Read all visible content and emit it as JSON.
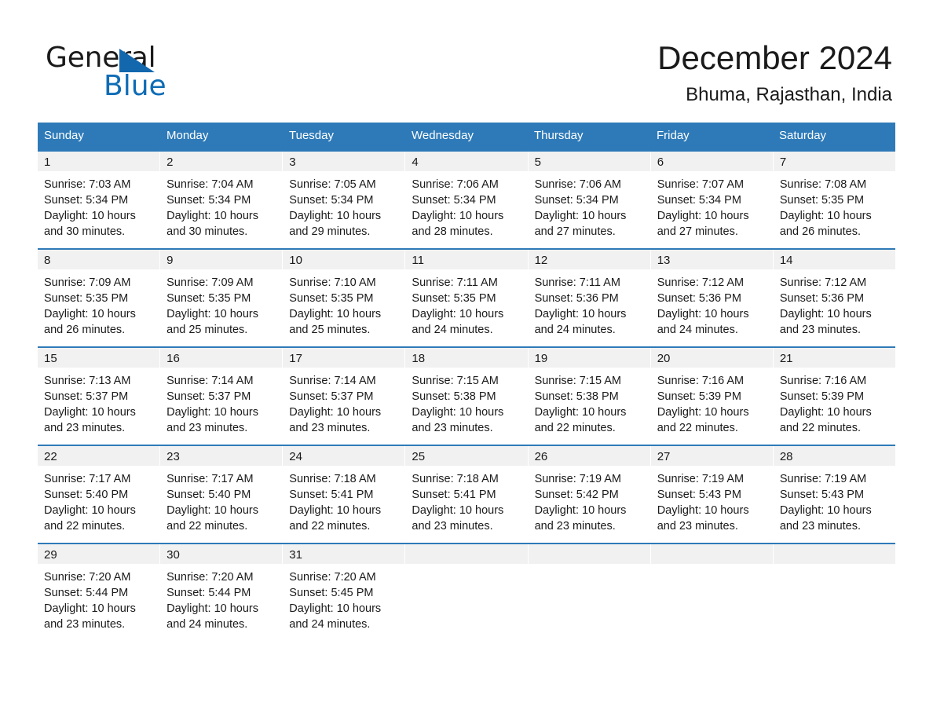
{
  "logo": {
    "word1": "General",
    "word2": "Blue",
    "triangle_color": "#1267ad",
    "blue_color": "#0f6cb5"
  },
  "header": {
    "title": "December 2024",
    "location": "Bhuma, Rajasthan, India"
  },
  "theme": {
    "header_blue": "#2e7ab8",
    "day_number_bg": "#f1f1f1"
  },
  "weekdays": [
    "Sunday",
    "Monday",
    "Tuesday",
    "Wednesday",
    "Thursday",
    "Friday",
    "Saturday"
  ],
  "weeks": [
    [
      {
        "day": "1",
        "sunrise": "Sunrise: 7:03 AM",
        "sunset": "Sunset: 5:34 PM",
        "daylight": "Daylight: 10 hours and 30 minutes."
      },
      {
        "day": "2",
        "sunrise": "Sunrise: 7:04 AM",
        "sunset": "Sunset: 5:34 PM",
        "daylight": "Daylight: 10 hours and 30 minutes."
      },
      {
        "day": "3",
        "sunrise": "Sunrise: 7:05 AM",
        "sunset": "Sunset: 5:34 PM",
        "daylight": "Daylight: 10 hours and 29 minutes."
      },
      {
        "day": "4",
        "sunrise": "Sunrise: 7:06 AM",
        "sunset": "Sunset: 5:34 PM",
        "daylight": "Daylight: 10 hours and 28 minutes."
      },
      {
        "day": "5",
        "sunrise": "Sunrise: 7:06 AM",
        "sunset": "Sunset: 5:34 PM",
        "daylight": "Daylight: 10 hours and 27 minutes."
      },
      {
        "day": "6",
        "sunrise": "Sunrise: 7:07 AM",
        "sunset": "Sunset: 5:34 PM",
        "daylight": "Daylight: 10 hours and 27 minutes."
      },
      {
        "day": "7",
        "sunrise": "Sunrise: 7:08 AM",
        "sunset": "Sunset: 5:35 PM",
        "daylight": "Daylight: 10 hours and 26 minutes."
      }
    ],
    [
      {
        "day": "8",
        "sunrise": "Sunrise: 7:09 AM",
        "sunset": "Sunset: 5:35 PM",
        "daylight": "Daylight: 10 hours and 26 minutes."
      },
      {
        "day": "9",
        "sunrise": "Sunrise: 7:09 AM",
        "sunset": "Sunset: 5:35 PM",
        "daylight": "Daylight: 10 hours and 25 minutes."
      },
      {
        "day": "10",
        "sunrise": "Sunrise: 7:10 AM",
        "sunset": "Sunset: 5:35 PM",
        "daylight": "Daylight: 10 hours and 25 minutes."
      },
      {
        "day": "11",
        "sunrise": "Sunrise: 7:11 AM",
        "sunset": "Sunset: 5:35 PM",
        "daylight": "Daylight: 10 hours and 24 minutes."
      },
      {
        "day": "12",
        "sunrise": "Sunrise: 7:11 AM",
        "sunset": "Sunset: 5:36 PM",
        "daylight": "Daylight: 10 hours and 24 minutes."
      },
      {
        "day": "13",
        "sunrise": "Sunrise: 7:12 AM",
        "sunset": "Sunset: 5:36 PM",
        "daylight": "Daylight: 10 hours and 24 minutes."
      },
      {
        "day": "14",
        "sunrise": "Sunrise: 7:12 AM",
        "sunset": "Sunset: 5:36 PM",
        "daylight": "Daylight: 10 hours and 23 minutes."
      }
    ],
    [
      {
        "day": "15",
        "sunrise": "Sunrise: 7:13 AM",
        "sunset": "Sunset: 5:37 PM",
        "daylight": "Daylight: 10 hours and 23 minutes."
      },
      {
        "day": "16",
        "sunrise": "Sunrise: 7:14 AM",
        "sunset": "Sunset: 5:37 PM",
        "daylight": "Daylight: 10 hours and 23 minutes."
      },
      {
        "day": "17",
        "sunrise": "Sunrise: 7:14 AM",
        "sunset": "Sunset: 5:37 PM",
        "daylight": "Daylight: 10 hours and 23 minutes."
      },
      {
        "day": "18",
        "sunrise": "Sunrise: 7:15 AM",
        "sunset": "Sunset: 5:38 PM",
        "daylight": "Daylight: 10 hours and 23 minutes."
      },
      {
        "day": "19",
        "sunrise": "Sunrise: 7:15 AM",
        "sunset": "Sunset: 5:38 PM",
        "daylight": "Daylight: 10 hours and 22 minutes."
      },
      {
        "day": "20",
        "sunrise": "Sunrise: 7:16 AM",
        "sunset": "Sunset: 5:39 PM",
        "daylight": "Daylight: 10 hours and 22 minutes."
      },
      {
        "day": "21",
        "sunrise": "Sunrise: 7:16 AM",
        "sunset": "Sunset: 5:39 PM",
        "daylight": "Daylight: 10 hours and 22 minutes."
      }
    ],
    [
      {
        "day": "22",
        "sunrise": "Sunrise: 7:17 AM",
        "sunset": "Sunset: 5:40 PM",
        "daylight": "Daylight: 10 hours and 22 minutes."
      },
      {
        "day": "23",
        "sunrise": "Sunrise: 7:17 AM",
        "sunset": "Sunset: 5:40 PM",
        "daylight": "Daylight: 10 hours and 22 minutes."
      },
      {
        "day": "24",
        "sunrise": "Sunrise: 7:18 AM",
        "sunset": "Sunset: 5:41 PM",
        "daylight": "Daylight: 10 hours and 22 minutes."
      },
      {
        "day": "25",
        "sunrise": "Sunrise: 7:18 AM",
        "sunset": "Sunset: 5:41 PM",
        "daylight": "Daylight: 10 hours and 23 minutes."
      },
      {
        "day": "26",
        "sunrise": "Sunrise: 7:19 AM",
        "sunset": "Sunset: 5:42 PM",
        "daylight": "Daylight: 10 hours and 23 minutes."
      },
      {
        "day": "27",
        "sunrise": "Sunrise: 7:19 AM",
        "sunset": "Sunset: 5:43 PM",
        "daylight": "Daylight: 10 hours and 23 minutes."
      },
      {
        "day": "28",
        "sunrise": "Sunrise: 7:19 AM",
        "sunset": "Sunset: 5:43 PM",
        "daylight": "Daylight: 10 hours and 23 minutes."
      }
    ],
    [
      {
        "day": "29",
        "sunrise": "Sunrise: 7:20 AM",
        "sunset": "Sunset: 5:44 PM",
        "daylight": "Daylight: 10 hours and 23 minutes."
      },
      {
        "day": "30",
        "sunrise": "Sunrise: 7:20 AM",
        "sunset": "Sunset: 5:44 PM",
        "daylight": "Daylight: 10 hours and 24 minutes."
      },
      {
        "day": "31",
        "sunrise": "Sunrise: 7:20 AM",
        "sunset": "Sunset: 5:45 PM",
        "daylight": "Daylight: 10 hours and 24 minutes."
      },
      {
        "day": "",
        "sunrise": "",
        "sunset": "",
        "daylight": ""
      },
      {
        "day": "",
        "sunrise": "",
        "sunset": "",
        "daylight": ""
      },
      {
        "day": "",
        "sunrise": "",
        "sunset": "",
        "daylight": ""
      },
      {
        "day": "",
        "sunrise": "",
        "sunset": "",
        "daylight": ""
      }
    ]
  ]
}
